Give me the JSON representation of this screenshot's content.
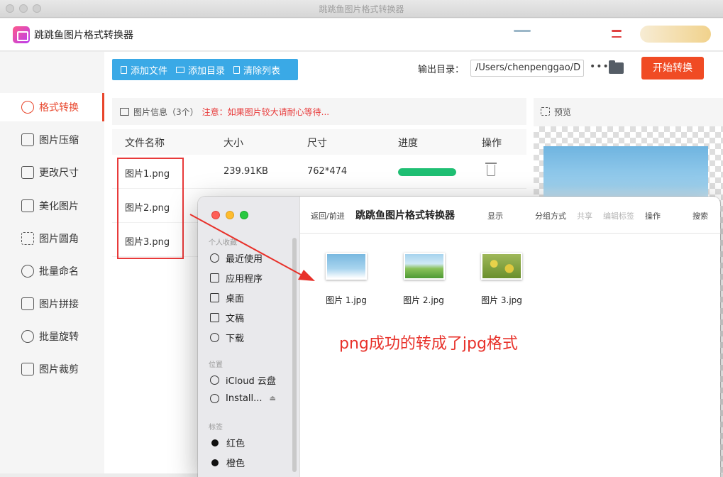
{
  "window": {
    "title": "跳跳鱼图片格式转换器"
  },
  "app": {
    "name": "跳跳鱼图片格式转换器"
  },
  "sidebar": {
    "items": [
      {
        "label": "格式转换",
        "icon": "format-convert-icon",
        "active": true
      },
      {
        "label": "图片压缩",
        "icon": "compress-icon"
      },
      {
        "label": "更改尺寸",
        "icon": "resize-icon"
      },
      {
        "label": "美化图片",
        "icon": "beautify-icon"
      },
      {
        "label": "图片圆角",
        "icon": "round-corner-icon"
      },
      {
        "label": "批量命名",
        "icon": "rename-icon"
      },
      {
        "label": "图片拼接",
        "icon": "stitch-icon"
      },
      {
        "label": "批量旋转",
        "icon": "rotate-icon"
      },
      {
        "label": "图片裁剪",
        "icon": "crop-icon"
      }
    ]
  },
  "toolbar": {
    "add_file": "添加文件",
    "add_dir": "添加目录",
    "clear_list": "清除列表"
  },
  "output": {
    "label": "输出目录：",
    "path": "/Users/chenpenggao/D",
    "more": "•••",
    "start": "开始转换"
  },
  "info": {
    "title": "图片信息（3个）",
    "warning": "注意：如果图片较大请耐心等待..."
  },
  "table": {
    "headers": [
      "文件名称",
      "大小",
      "尺寸",
      "进度",
      "操作"
    ],
    "rows": [
      {
        "name": "图片1.png",
        "size": "239.91KB",
        "dims": "762*474",
        "progress": 1.0
      },
      {
        "name": "图片2.png",
        "size": "",
        "dims": "",
        "progress": null
      },
      {
        "name": "图片3.png",
        "size": "",
        "dims": "",
        "progress": null
      }
    ]
  },
  "preview": {
    "title": "预览"
  },
  "finder": {
    "toolbar": {
      "nav": "返回/前进",
      "title": "跳跳鱼图片格式转换器",
      "view": "显示",
      "group": "分组方式",
      "share": "共享",
      "tags": "编辑标签",
      "action": "操作",
      "search": "搜索"
    },
    "sections": {
      "favorites": "个人收藏",
      "locations": "位置",
      "tags": "标签"
    },
    "favorites": [
      {
        "label": "最近使用",
        "icon": "clock-icon"
      },
      {
        "label": "应用程序",
        "icon": "apps-icon"
      },
      {
        "label": "桌面",
        "icon": "desktop-icon"
      },
      {
        "label": "文稿",
        "icon": "document-icon"
      },
      {
        "label": "下载",
        "icon": "download-icon"
      }
    ],
    "locations": [
      {
        "label": "iCloud 云盘",
        "icon": "cloud-icon"
      },
      {
        "label": "Install...",
        "icon": "disk-icon"
      }
    ],
    "tags": [
      {
        "label": "红色",
        "color": "#111111"
      },
      {
        "label": "橙色",
        "color": "#111111"
      }
    ],
    "files": [
      {
        "name": "图片 1.jpg"
      },
      {
        "name": "图片 2.jpg"
      },
      {
        "name": "图片 3.jpg"
      }
    ]
  },
  "annotation": {
    "text": "png成功的转成了jpg格式",
    "color": "#e8312a"
  }
}
